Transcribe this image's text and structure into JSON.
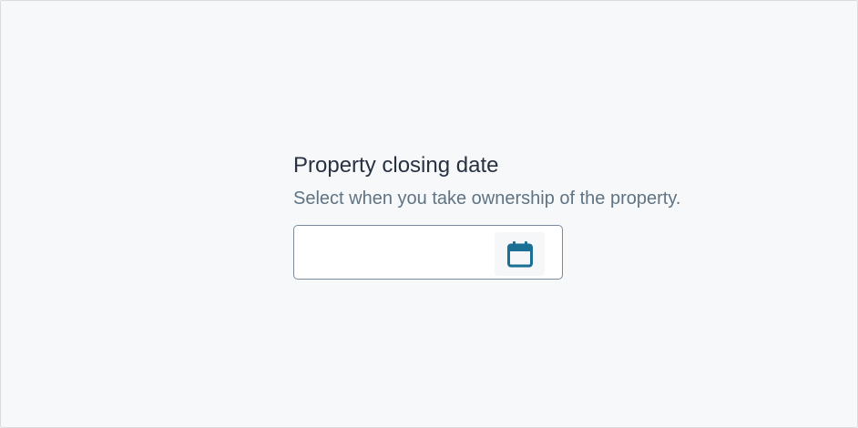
{
  "field": {
    "label": "Property closing date",
    "hint": "Select when you take ownership of the property.",
    "value": "",
    "placeholder": ""
  },
  "icons": {
    "calendar_button": "calendar-icon"
  },
  "colors": {
    "background": "#f7f8fa",
    "label_text": "#273142",
    "hint_text": "#5f7383",
    "input_border": "#7a8a9a",
    "icon_accent": "#1a6f93"
  }
}
